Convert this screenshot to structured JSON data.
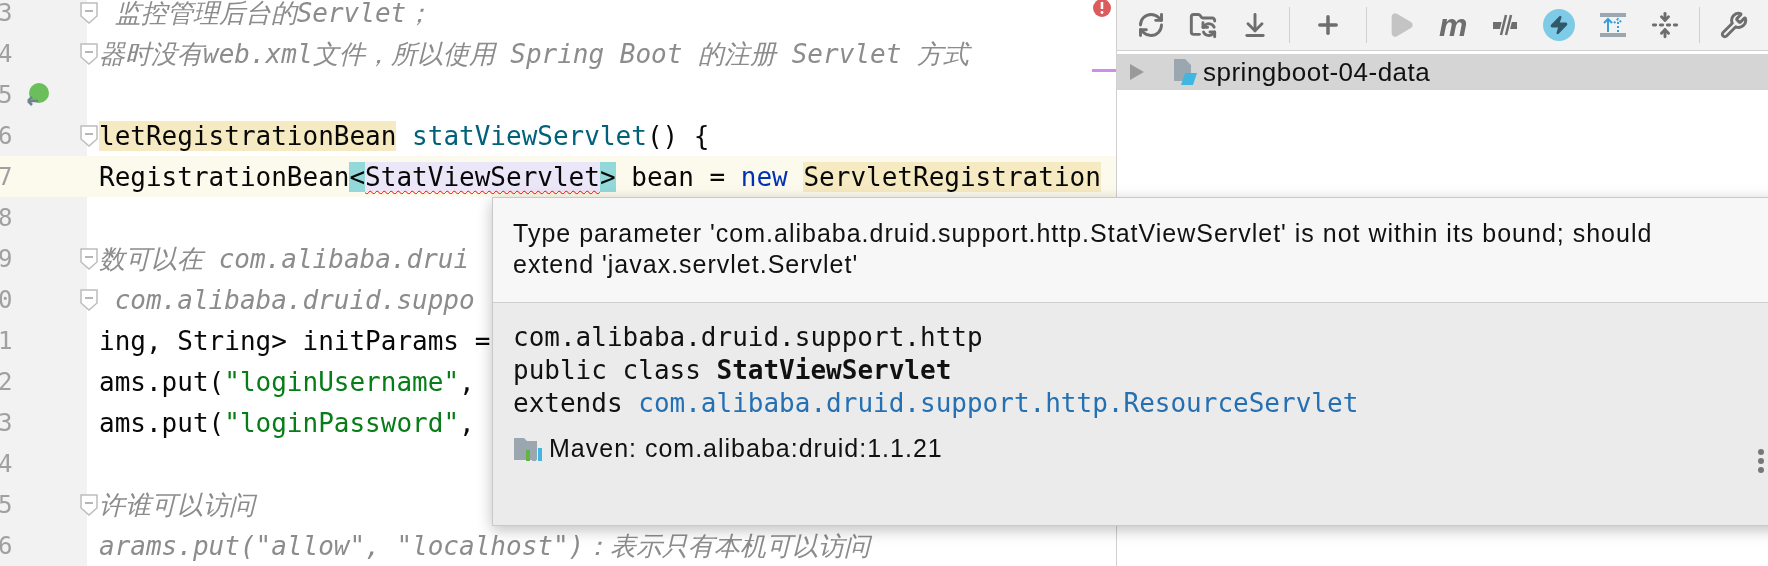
{
  "editor": {
    "lines": [
      {
        "number": "3",
        "fold": true,
        "marker": false,
        "current": false,
        "segments": [
          {
            "kind": "comment",
            "text": " 监控管理后台的Servlet；"
          }
        ]
      },
      {
        "number": "4",
        "fold": true,
        "marker": false,
        "current": false,
        "segments": [
          {
            "kind": "comment",
            "text": "器时没有web.xml文件，所以使用 Spring Boot 的注册 Servlet 方式"
          }
        ]
      },
      {
        "number": "5",
        "fold": false,
        "marker": true,
        "current": false
      },
      {
        "number": "6",
        "fold": true,
        "marker": false,
        "current": false,
        "segments": [
          {
            "kind": "usage",
            "text": "letRegistrationBean"
          },
          {
            "kind": "method",
            "text": " statViewServlet"
          },
          {
            "kind": "plain",
            "text": "() {"
          }
        ]
      },
      {
        "number": "7",
        "fold": false,
        "marker": false,
        "current": true,
        "segments": [
          {
            "kind": "plain",
            "text": "RegistrationBean"
          },
          {
            "kind": "bracket",
            "text": "<"
          },
          {
            "kind": "error",
            "text": "StatViewServlet"
          },
          {
            "kind": "bracket",
            "text": ">"
          },
          {
            "kind": "plain",
            "text": " bean = "
          },
          {
            "kind": "keyword",
            "text": "new "
          },
          {
            "kind": "usage",
            "text": "ServletRegistration"
          }
        ]
      },
      {
        "number": "8",
        "fold": false,
        "marker": false,
        "current": false
      },
      {
        "number": "9",
        "fold": true,
        "marker": false,
        "current": false,
        "segments": [
          {
            "kind": "comment",
            "text": "数可以在 com.alibaba.drui"
          }
        ]
      },
      {
        "number": "0",
        "fold": true,
        "marker": false,
        "current": false,
        "segments": [
          {
            "kind": "comment",
            "text": " com.alibaba.druid.suppo"
          }
        ]
      },
      {
        "number": "1",
        "fold": false,
        "marker": false,
        "current": false,
        "segments": [
          {
            "kind": "plain",
            "text": "ing, String> initParams ="
          }
        ]
      },
      {
        "number": "2",
        "fold": false,
        "marker": false,
        "current": false,
        "segments": [
          {
            "kind": "plain",
            "text": "ams.put("
          },
          {
            "kind": "string",
            "text": "\"loginUsername\""
          },
          {
            "kind": "plain",
            "text": ","
          }
        ]
      },
      {
        "number": "3",
        "fold": false,
        "marker": false,
        "current": false,
        "segments": [
          {
            "kind": "plain",
            "text": "ams.put("
          },
          {
            "kind": "string",
            "text": "\"loginPassword\""
          },
          {
            "kind": "plain",
            "text": ","
          }
        ]
      },
      {
        "number": "4",
        "fold": false,
        "marker": false,
        "current": false
      },
      {
        "number": "5",
        "fold": true,
        "marker": false,
        "current": false,
        "segments": [
          {
            "kind": "comment",
            "text": "许谁可以访问"
          }
        ]
      },
      {
        "number": "6",
        "fold": false,
        "marker": false,
        "current": false,
        "segments": [
          {
            "kind": "comment",
            "text": "arams.put(\"allow\", \"localhost\")：表示只有本机可以访问"
          }
        ]
      }
    ]
  },
  "popup": {
    "message": "Type parameter 'com.alibaba.druid.support.http.StatViewServlet' is not within its bound; should extend 'javax.servlet.Servlet'",
    "package": "com.alibaba.druid.support.http",
    "declaration": "public class ",
    "class_name": "StatViewServlet",
    "extends_keyword": "extends ",
    "superclass": "com.alibaba.druid.support.http.ResourceServlet",
    "library": "Maven: com.alibaba:druid:1.1.21"
  },
  "maven_panel": {
    "toolbar": [
      {
        "kind": "refresh"
      },
      {
        "kind": "folder-refresh"
      },
      {
        "kind": "download"
      },
      {
        "kind": "separator"
      },
      {
        "kind": "plus"
      },
      {
        "kind": "separator"
      },
      {
        "kind": "run"
      },
      {
        "kind": "label",
        "label": "m"
      },
      {
        "kind": "skip"
      },
      {
        "kind": "offline"
      },
      {
        "kind": "dependencies"
      },
      {
        "kind": "collapse"
      },
      {
        "kind": "separator"
      },
      {
        "kind": "wrench"
      }
    ],
    "tree": [
      {
        "label": "springboot-04-data",
        "expanded": false,
        "selected": true
      }
    ]
  }
}
